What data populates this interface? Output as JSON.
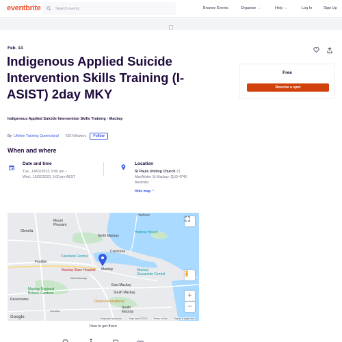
{
  "header": {
    "logo": "eventbrite",
    "search_placeholder": "Search events",
    "nav": {
      "browse": "Browse Events",
      "organise": "Organise",
      "help": "Help",
      "login": "Log In",
      "signup": "Sign Up"
    }
  },
  "event": {
    "date_short": "Feb. 14",
    "title": "Indigenous Applied Suicide Intervention Skills Training (I-ASIST) 2day MKY",
    "summary": "Indigenous Applied Suicide Intervention Skills Training - Mackay",
    "by_prefix": "By",
    "organizer": "Lifeline Training Queensland",
    "followers": "632 followers",
    "follow_label": "Follow"
  },
  "ticket": {
    "price": "Free",
    "reserve_label": "Reserve a spot"
  },
  "when_where": {
    "heading": "When and where",
    "date_title": "Date and time",
    "date_line1": "Tue., 14/02/2023, 9:00 am –",
    "date_line2": "Wed., 15/02/2023, 5:00 pm AEST",
    "location_title": "Location",
    "venue": "St Pauls Uniting Church",
    "address_line1": "21",
    "address_line2": "MacAlister St Mackay, QLD 4740",
    "address_line3": "Australia",
    "hide_map": "Hide map"
  },
  "map": {
    "labels": {
      "harbour": "Harbour",
      "mount_pleasant": "Mount\nPleasant",
      "glenella": "Glenella",
      "north_mackay": "North Mackay",
      "harbour_beach": "Harbour Beach",
      "foulden": "Foulden",
      "caneland": "Caneland Central",
      "cremorne": "Cremorne",
      "mackay_base_hospital": "Mackay Base Hospital",
      "mackay": "Mackay",
      "mackay_oceanside": "Mackay\nOceanside Central",
      "east_mackay": "East Mackay",
      "mackay_botanic": "Mackay Regional\nBotanic Gardens",
      "racecourse": "Racecourse",
      "ooralea": "Ooralea",
      "ocean_international": "Ocean International",
      "south_mackay": "South Mackay",
      "west_mackay": "West Mackay",
      "south_mackay2": "South\nMackay"
    },
    "footer": {
      "shortcuts": "Keyboard shortcuts",
      "data": "Map data ©2023",
      "terms": "Terms of Use",
      "report": "Report a map error"
    },
    "google": "Google"
  },
  "directions_label": "How to get there",
  "colors": {
    "brand": "#f05537",
    "reserve": "#d1410c",
    "link": "#3659e3",
    "text": "#1e0a3c"
  }
}
